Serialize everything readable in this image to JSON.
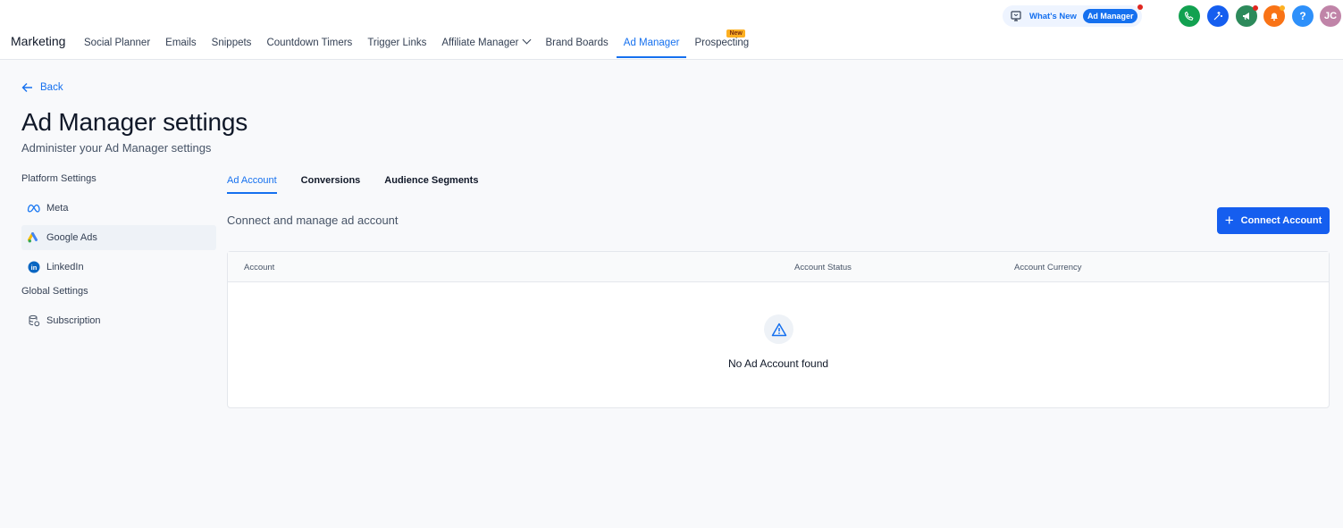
{
  "header": {
    "brand": "Marketing",
    "nav": [
      {
        "label": "Social Planner"
      },
      {
        "label": "Emails"
      },
      {
        "label": "Snippets"
      },
      {
        "label": "Countdown Timers"
      },
      {
        "label": "Trigger Links"
      },
      {
        "label": "Affiliate Manager"
      },
      {
        "label": "Brand Boards"
      },
      {
        "label": "Ad Manager"
      },
      {
        "label": "Prospecting"
      }
    ],
    "new_badge": "New",
    "whats_new": {
      "label": "What's New",
      "pill": "Ad Manager"
    },
    "avatar_initials": "JC",
    "help_glyph": "?",
    "colors": {
      "accent": "#1570ef",
      "phone": "#12a150",
      "magic": "#155eef",
      "megaphone": "#2d8a5b",
      "bell": "#f97316",
      "help": "#2e90fa",
      "avatar": "#c084a8"
    }
  },
  "page": {
    "back_label": "Back",
    "title": "Ad Manager settings",
    "subtitle": "Administer your Ad Manager settings"
  },
  "sidebar": {
    "platform_heading": "Platform Settings",
    "platform_items": [
      {
        "label": "Meta",
        "icon": "meta-icon"
      },
      {
        "label": "Google Ads",
        "icon": "google-ads-icon"
      },
      {
        "label": "LinkedIn",
        "icon": "linkedin-icon"
      }
    ],
    "global_heading": "Global Settings",
    "global_items": [
      {
        "label": "Subscription",
        "icon": "database-icon"
      }
    ]
  },
  "tabs": [
    {
      "label": "Ad Account"
    },
    {
      "label": "Conversions"
    },
    {
      "label": "Audience Segments"
    }
  ],
  "content": {
    "description": "Connect and manage ad account",
    "connect_button": "Connect Account",
    "table": {
      "columns": [
        "Account",
        "Account Status",
        "Account Currency"
      ],
      "empty_message": "No Ad Account found"
    }
  }
}
